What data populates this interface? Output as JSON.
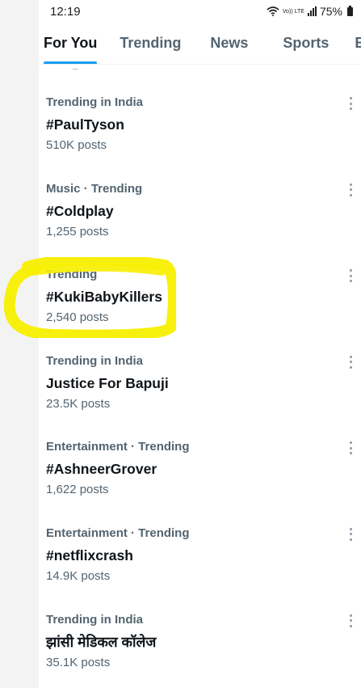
{
  "status_bar": {
    "time": "12:19",
    "volte_label": "Vo)) LTE",
    "battery_percent": "75%"
  },
  "tabs": [
    {
      "label": "For You",
      "active": true
    },
    {
      "label": "Trending",
      "active": false
    },
    {
      "label": "News",
      "active": false
    },
    {
      "label": "Sports",
      "active": false
    },
    {
      "label": "Er",
      "active": false
    }
  ],
  "trends": [
    {
      "context": "Trending in India",
      "name": "#PaulTyson",
      "count": "510K posts"
    },
    {
      "context": "Music · Trending",
      "name": "#Coldplay",
      "count": "1,255 posts"
    },
    {
      "context": "Trending",
      "name": "#KukiBabyKillers",
      "count": "2,540 posts"
    },
    {
      "context": "Trending in India",
      "name": "Justice For Bapuji",
      "count": "23.5K posts"
    },
    {
      "context": "Entertainment · Trending",
      "name": "#AshneerGrover",
      "count": "1,622 posts"
    },
    {
      "context": "Entertainment · Trending",
      "name": "#netflixcrash",
      "count": "14.9K posts"
    },
    {
      "context": "Trending in India",
      "name": "झांसी मेडिकल कॉलेज",
      "count": "35.1K posts"
    }
  ],
  "colors": {
    "accent": "#1d9bf0",
    "highlight": "#f7ef00",
    "secondary_text": "#536471"
  }
}
